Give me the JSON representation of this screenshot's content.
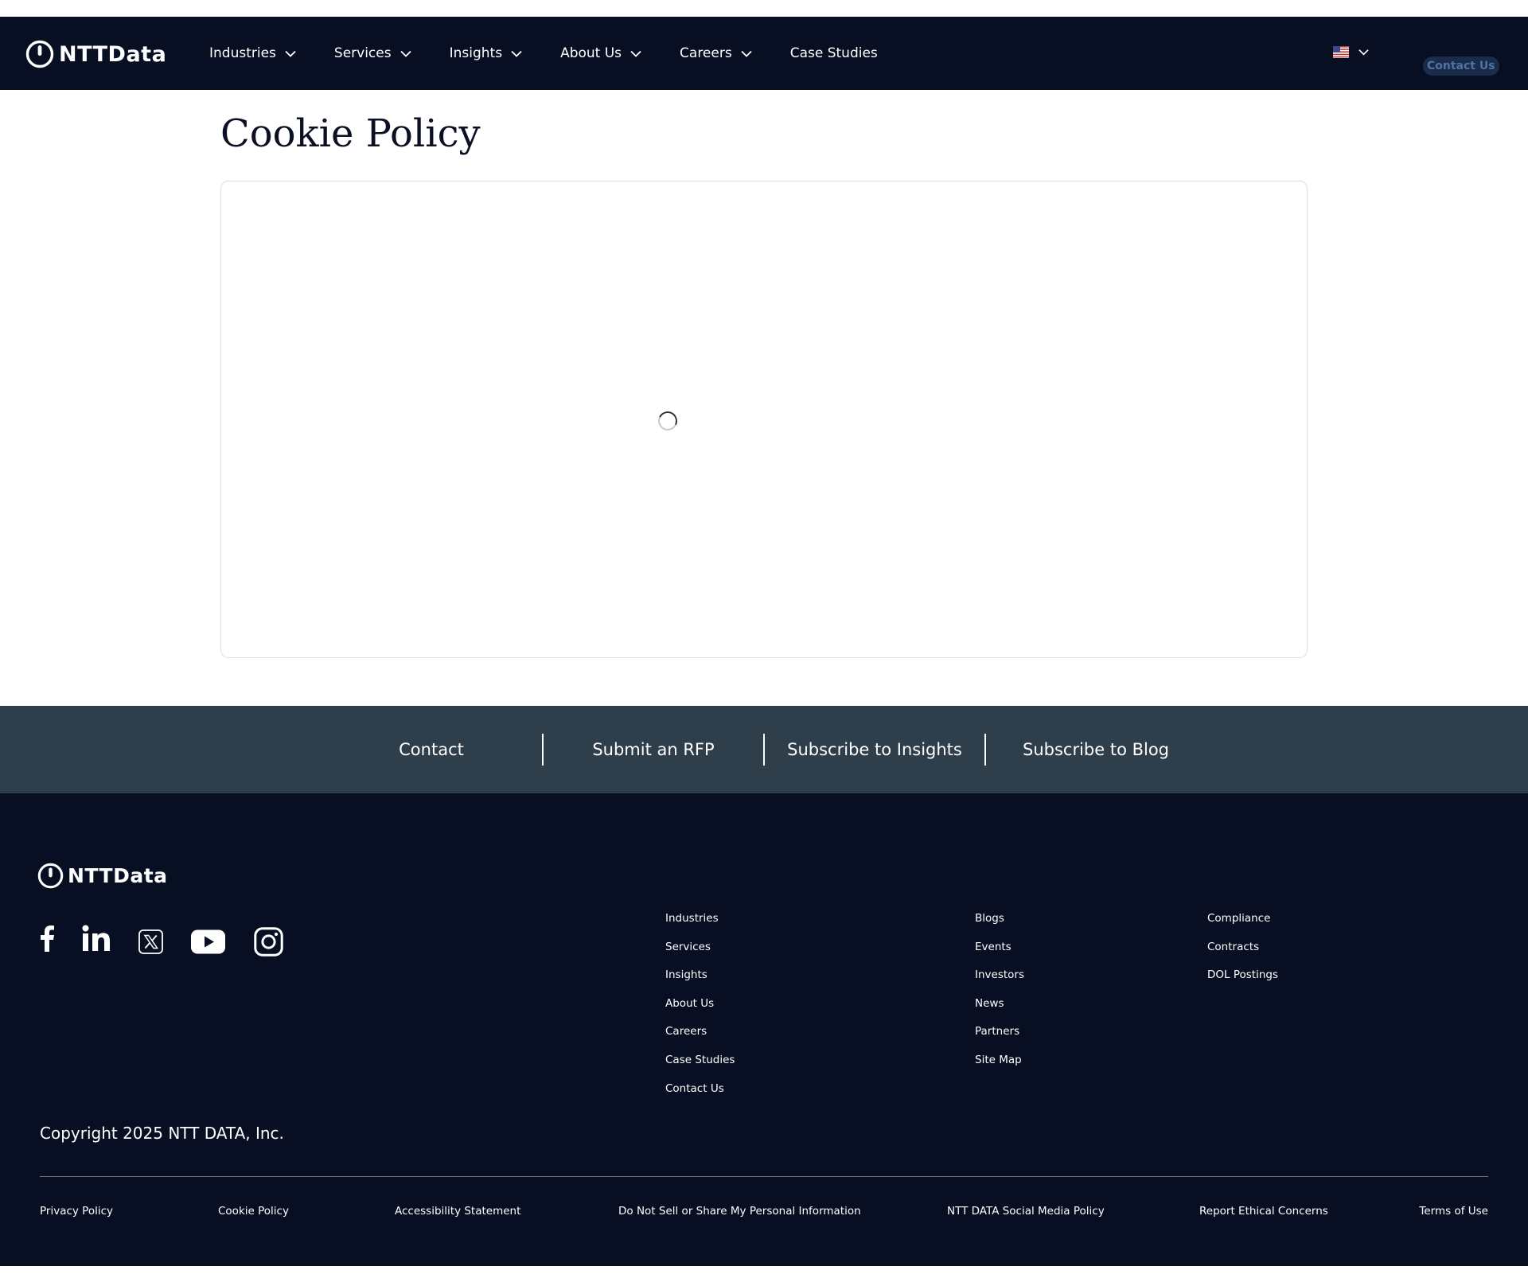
{
  "header": {
    "logo_text": "NTTData",
    "nav": [
      {
        "label": "Industries",
        "has_dropdown": true
      },
      {
        "label": "Services",
        "has_dropdown": true
      },
      {
        "label": "Insights",
        "has_dropdown": true
      },
      {
        "label": "About Us",
        "has_dropdown": true
      },
      {
        "label": "Careers",
        "has_dropdown": true
      },
      {
        "label": "Case Studies",
        "has_dropdown": false
      }
    ],
    "language_icon": "us-flag-icon",
    "contact_label": "Contact Us"
  },
  "main": {
    "title": "Cookie Policy",
    "loading_icon": "spinner-icon"
  },
  "cta_band": {
    "items": [
      "Contact",
      "Submit an RFP",
      "Subscribe to Insights",
      "Subscribe to Blog"
    ]
  },
  "footer": {
    "logo_text": "NTTData",
    "social_icons": [
      "facebook-icon",
      "linkedin-icon",
      "x-twitter-icon",
      "youtube-icon",
      "instagram-icon"
    ],
    "columns": [
      [
        "Industries",
        "Services",
        "Insights",
        "About Us",
        "Careers",
        "Case Studies",
        "Contact Us"
      ],
      [
        "Blogs",
        "Events",
        "Investors",
        "News",
        "Partners",
        "Site Map"
      ],
      [
        "Compliance",
        "Contracts",
        "DOL Postings"
      ]
    ],
    "copyright": "Copyright 2025 NTT DATA, Inc.",
    "legal_links": [
      "Privacy Policy",
      "Cookie Policy",
      "Accessibility Statement",
      "Do Not Sell or Share My Personal Information",
      "NTT DATA Social Media Policy",
      "Report Ethical Concerns",
      "Terms of Use"
    ]
  },
  "colors": {
    "header_bg": "#080f22",
    "cta_band_bg": "#2f3e4b",
    "footer_bg": "#080f22",
    "contact_button_bg": "#1b2c4a",
    "contact_button_text": "#4f73a5"
  }
}
